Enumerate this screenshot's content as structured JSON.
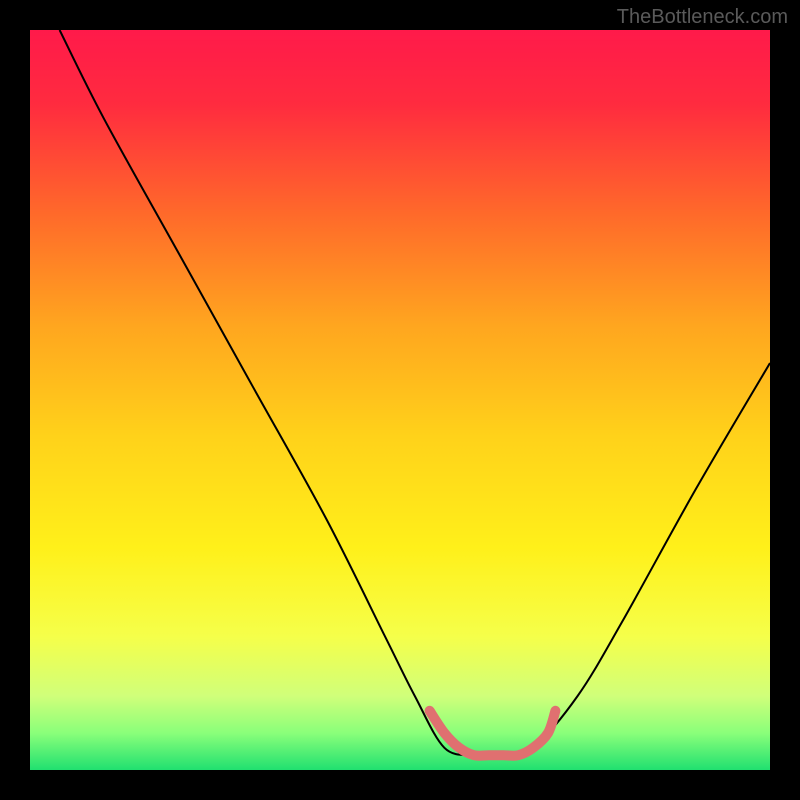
{
  "watermark": "TheBottleneck.com",
  "chart_data": {
    "type": "line",
    "title": "",
    "xlabel": "",
    "ylabel": "",
    "xlim": [
      0,
      100
    ],
    "ylim": [
      0,
      100
    ],
    "series": [
      {
        "name": "main-curve",
        "stroke": "#000000",
        "x": [
          4,
          10,
          20,
          30,
          40,
          48,
          52,
          56,
          60,
          62,
          64,
          68,
          74,
          80,
          90,
          100
        ],
        "y": [
          100,
          88,
          70,
          52,
          34,
          18,
          10,
          3,
          2,
          2,
          2,
          3,
          10,
          20,
          38,
          55
        ]
      },
      {
        "name": "highlight-segment",
        "stroke": "#e07070",
        "x": [
          54,
          56,
          58,
          60,
          62,
          64,
          66,
          68,
          70,
          71
        ],
        "y": [
          8,
          5,
          3,
          2,
          2,
          2,
          2,
          3,
          5,
          8
        ]
      }
    ],
    "gradient_stops": [
      {
        "offset": 0.0,
        "color": "#ff1a4a"
      },
      {
        "offset": 0.1,
        "color": "#ff2b3f"
      },
      {
        "offset": 0.25,
        "color": "#ff6a2a"
      },
      {
        "offset": 0.4,
        "color": "#ffa61f"
      },
      {
        "offset": 0.55,
        "color": "#ffd21a"
      },
      {
        "offset": 0.7,
        "color": "#fff01a"
      },
      {
        "offset": 0.82,
        "color": "#f5ff4a"
      },
      {
        "offset": 0.9,
        "color": "#d0ff7a"
      },
      {
        "offset": 0.95,
        "color": "#8aff7a"
      },
      {
        "offset": 1.0,
        "color": "#20e070"
      }
    ]
  }
}
